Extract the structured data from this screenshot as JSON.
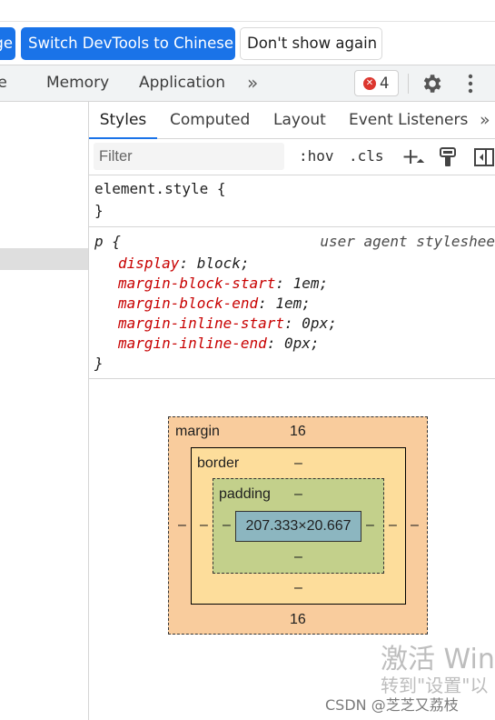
{
  "infobar": {
    "lang_button_tail": "ge",
    "switch_button": "Switch DevTools to Chinese",
    "dont_show_button": "Don't show again"
  },
  "tabs": {
    "partial": "ce",
    "memory": "Memory",
    "application": "Application",
    "more": "»",
    "error_count": "4",
    "error_icon": "x-circle-icon"
  },
  "subtabs": {
    "styles": "Styles",
    "computed": "Computed",
    "layout": "Layout",
    "event_listeners": "Event Listeners",
    "more": "»"
  },
  "filter": {
    "placeholder": "Filter",
    "hov": ":hov",
    "cls": ".cls",
    "plus": "+"
  },
  "element_style": {
    "selector": "element.style {",
    "close": "}"
  },
  "ua_rule": {
    "selector": "p {",
    "source": "user agent styleshee",
    "declarations": [
      {
        "prop": "display",
        "value": "block;"
      },
      {
        "prop": "margin-block-start",
        "value": "1em;"
      },
      {
        "prop": "margin-block-end",
        "value": "1em;"
      },
      {
        "prop": "margin-inline-start",
        "value": "0px;"
      },
      {
        "prop": "margin-inline-end",
        "value": "0px;"
      }
    ],
    "close": "}"
  },
  "box_model": {
    "margin_label": "margin",
    "margin_top": "16",
    "margin_bottom": "16",
    "margin_left": "–",
    "margin_right": "–",
    "border_label": "border",
    "border_top": "–",
    "border_bottom": "–",
    "border_left": "–",
    "border_right": "–",
    "padding_label": "padding",
    "padding_top": "–",
    "padding_bottom": "–",
    "padding_left": "–",
    "padding_right": "–",
    "content": "207.333×20.667",
    "colors": {
      "margin": "#f9cc9d",
      "border": "#fddd9b",
      "padding": "#c3d08b",
      "content": "#8cb6c0"
    }
  },
  "watermark": {
    "line1": "激活 Win",
    "line2": "转到\"设置\"以",
    "credit": "CSDN @芝芝又荔枝"
  }
}
